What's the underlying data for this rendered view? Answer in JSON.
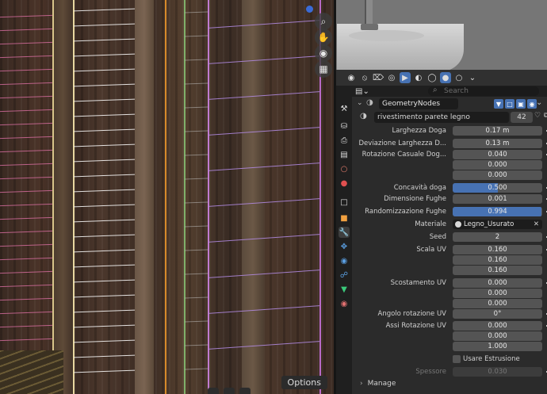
{
  "viewport": {
    "options_label": "Options",
    "gizmo_icons": [
      "zoom-icon",
      "pan-hand-icon",
      "camera-icon",
      "grid-icon"
    ]
  },
  "props_header_icons": [
    "view-icon",
    "overlay-icon",
    "snap-icon",
    "proportional-icon",
    "xray-icon",
    "shading-solid-icon",
    "shading-material-icon",
    "shading-rendered-icon"
  ],
  "properties": {
    "search_placeholder": "Search",
    "modifier_name": "GeometryNodes",
    "node_group_name": "rivestimento parete legno",
    "node_group_users": "42",
    "manage_label": "Manage"
  },
  "inputs": [
    {
      "label": "Larghezza Doga",
      "value": "0.17 m",
      "anim": true
    },
    {
      "label": "Deviazione Larghezza D...",
      "value": "0.13 m",
      "anim": true
    },
    {
      "label": "Rotazione Casuale Dog...",
      "value": "0.040",
      "anim": true
    },
    {
      "label": "",
      "value": "0.000",
      "anim": false
    },
    {
      "label": "",
      "value": "0.000",
      "anim": false
    },
    {
      "label": "Concavità doga",
      "value": "0.500",
      "fill": 0.5,
      "anim": true
    },
    {
      "label": "Dimensione Fughe",
      "value": "0.001",
      "anim": true
    },
    {
      "label": "Randomizzazione Fughe",
      "value": "0.994",
      "fill": 0.994,
      "anim": true
    },
    {
      "label": "Materiale",
      "value": "Legno_Usurato",
      "type": "material"
    },
    {
      "label": "Seed",
      "value": "2",
      "anim": true
    },
    {
      "label": "Scala UV",
      "value": "0.160",
      "anim": true
    },
    {
      "label": "",
      "value": "0.160",
      "anim": false
    },
    {
      "label": "",
      "value": "0.160",
      "anim": false
    },
    {
      "label": "Scostamento UV",
      "value": "0.000",
      "anim": true
    },
    {
      "label": "",
      "value": "0.000",
      "anim": false
    },
    {
      "label": "",
      "value": "0.000",
      "anim": false
    },
    {
      "label": "Angolo rotazione UV",
      "value": "0°",
      "anim": true
    },
    {
      "label": "Assi Rotazione UV",
      "value": "0.000",
      "anim": true
    },
    {
      "label": "",
      "value": "0.000",
      "anim": false
    },
    {
      "label": "",
      "value": "1.000",
      "anim": false
    },
    {
      "label": "Usare Estrusione",
      "type": "checkbox",
      "checked": false
    },
    {
      "label": "Spessore",
      "value": "0.030",
      "type": "disabled",
      "anim": true
    }
  ],
  "colors": {
    "accent": "#4772b3",
    "panel": "#2b2b2b",
    "field": "#545454"
  }
}
